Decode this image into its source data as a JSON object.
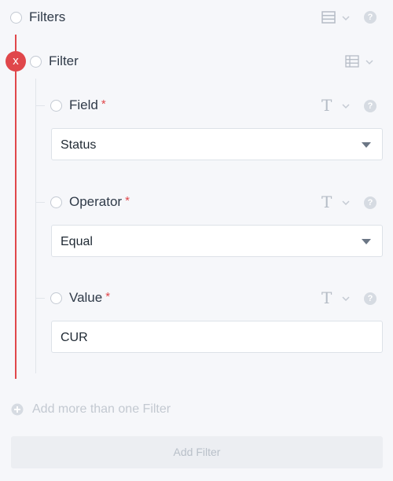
{
  "root": {
    "label": "Filters"
  },
  "filter": {
    "label": "Filter",
    "remove_label": "x"
  },
  "fields": [
    {
      "label": "Field",
      "required": "*",
      "value": "Status",
      "type_icon": "T"
    },
    {
      "label": "Operator",
      "required": "*",
      "value": "Equal",
      "type_icon": "T"
    },
    {
      "label": "Value",
      "required": "*",
      "value": "CUR",
      "type_icon": "T"
    }
  ],
  "help_glyph": "?",
  "add_more": {
    "label": "Add more than one Filter"
  },
  "add_button": {
    "label": "Add Filter"
  },
  "colors": {
    "accent_red": "#e0474b",
    "muted": "#c4cad3"
  }
}
